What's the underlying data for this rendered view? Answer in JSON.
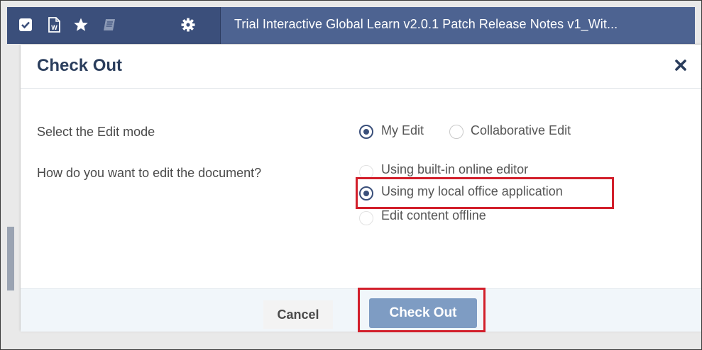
{
  "header": {
    "document_title": "Trial Interactive Global Learn v2.0.1 Patch Release Notes v1_Wit...",
    "icons": [
      "checkbox-icon",
      "word-document-icon",
      "star-icon",
      "book-icon",
      "gear-icon"
    ]
  },
  "dialog": {
    "title": "Check Out",
    "close_icon": "close-icon",
    "edit_mode": {
      "label": "Select the Edit mode",
      "options": [
        {
          "label": "My Edit",
          "selected": true
        },
        {
          "label": "Collaborative Edit",
          "selected": false
        }
      ]
    },
    "edit_method": {
      "label": "How do you want to edit the document?",
      "options": [
        {
          "label": "Using built-in online editor",
          "selected": false
        },
        {
          "label": "Using my local office application",
          "selected": true
        },
        {
          "label": "Edit content offline",
          "selected": false
        }
      ]
    },
    "buttons": {
      "cancel": "Cancel",
      "check_out": "Check Out"
    }
  },
  "colors": {
    "header_bg": "#3b4f7b",
    "accent": "#3a4f7a",
    "primary_button": "#7e9cc3",
    "highlight": "#d21f2b"
  }
}
